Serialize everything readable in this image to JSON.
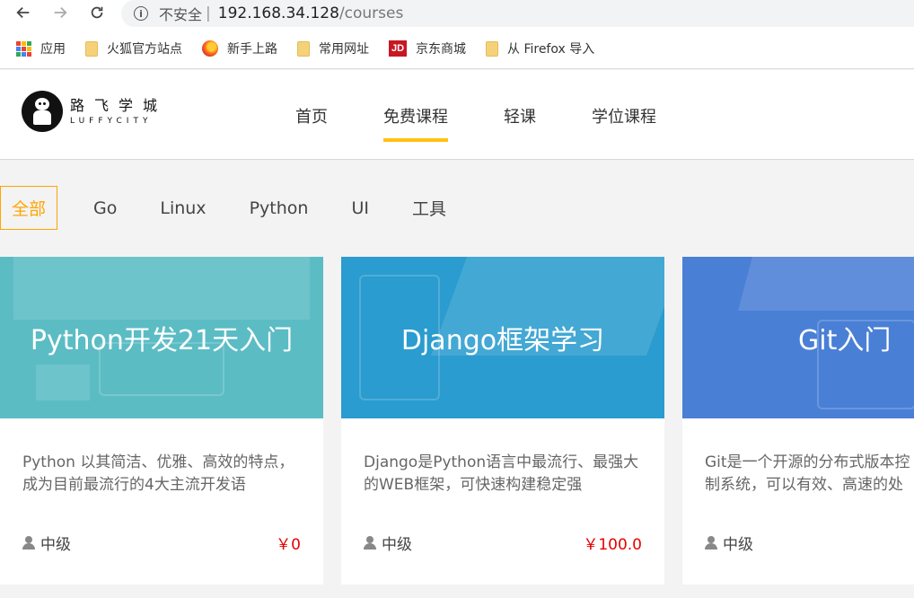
{
  "browser": {
    "insecure_label": "不安全",
    "separator": "|",
    "url_host": "192.168.34.128",
    "url_path": "/courses",
    "bookmarks": [
      {
        "label": "应用",
        "icon": "apps-grid-icon"
      },
      {
        "label": "火狐官方站点",
        "icon": "folder-icon"
      },
      {
        "label": "新手上路",
        "icon": "firefox-icon"
      },
      {
        "label": "常用网址",
        "icon": "folder-icon"
      },
      {
        "label": "京东商城",
        "icon": "jd-icon"
      },
      {
        "label": "从 Firefox 导入",
        "icon": "folder-icon"
      }
    ],
    "jd_logo_text": "JD"
  },
  "site": {
    "logo_cn": "路飞学城",
    "logo_en": "LUFFYCITY",
    "nav": [
      {
        "label": "首页",
        "active": false
      },
      {
        "label": "免费课程",
        "active": true
      },
      {
        "label": "轻课",
        "active": false
      },
      {
        "label": "学位课程",
        "active": false
      }
    ],
    "accent_color": "#ffc210"
  },
  "filters": [
    {
      "label": "全部",
      "active": true
    },
    {
      "label": "Go",
      "active": false
    },
    {
      "label": "Linux",
      "active": false
    },
    {
      "label": "Python",
      "active": false
    },
    {
      "label": "UI",
      "active": false
    },
    {
      "label": "工具",
      "active": false
    }
  ],
  "courses": [
    {
      "title": "Python开发21天入门",
      "description": "Python 以其简洁、优雅、高效的特点，成为目前最流行的4大主流开发语",
      "level": "中级",
      "price": "￥0",
      "banner_color": "#5bbcc4"
    },
    {
      "title": "Django框架学习",
      "description": "Django是Python语言中最流行、最强大的WEB框架，可快速构建稳定强",
      "level": "中级",
      "price": "￥100.0",
      "banner_color": "#2a9ccf"
    },
    {
      "title": "Git入门",
      "description": "Git是一个开源的分布式版本控制系统，可以有效、高速的处理从",
      "level": "中级",
      "price": "",
      "banner_color": "#4a7fd6"
    }
  ],
  "price_color": "#e60000"
}
